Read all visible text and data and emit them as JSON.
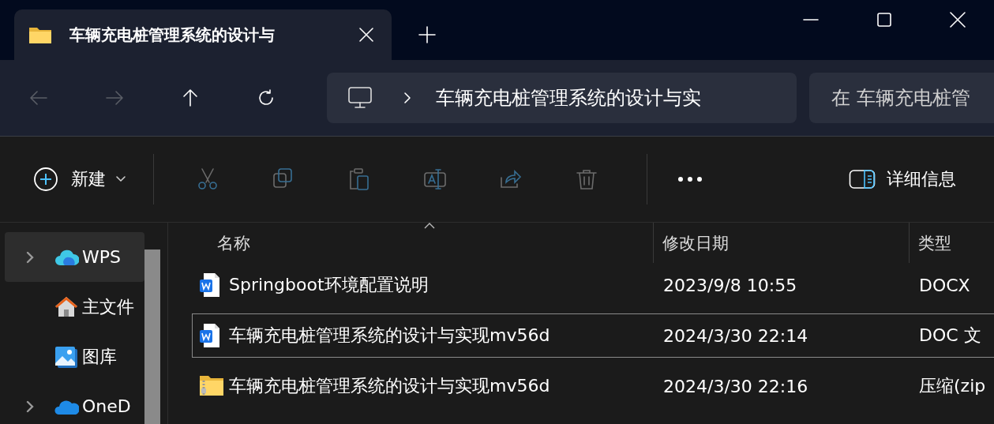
{
  "tab": {
    "title": "车辆充电桩管理系统的设计与"
  },
  "nav_buttons": [
    {
      "kind": "back",
      "disabled": true
    },
    {
      "kind": "forward",
      "disabled": true
    },
    {
      "kind": "up",
      "disabled": false
    },
    {
      "kind": "refresh",
      "disabled": false
    }
  ],
  "address": {
    "path": "车辆充电桩管理系统的设计与实"
  },
  "search": {
    "placeholder": "在 车辆充电桩管"
  },
  "toolbar": {
    "new_label": "新建",
    "actions": [
      {
        "kind": "cut",
        "disabled": true
      },
      {
        "kind": "copy",
        "disabled": true
      },
      {
        "kind": "paste",
        "disabled": true
      },
      {
        "kind": "rename",
        "disabled": true
      },
      {
        "kind": "share",
        "disabled": true
      },
      {
        "kind": "delete",
        "disabled": true
      }
    ],
    "details_label": "详细信息"
  },
  "sidebar": {
    "items": [
      {
        "label": "WPS",
        "kind": "cloud",
        "expandable": true,
        "selected": true
      },
      {
        "label": "主文件",
        "kind": "home",
        "expandable": false,
        "selected": false
      },
      {
        "label": "图库",
        "kind": "gallery",
        "expandable": false,
        "selected": false
      },
      {
        "label": "OneD",
        "kind": "onedrive",
        "expandable": true,
        "selected": false
      }
    ]
  },
  "table": {
    "columns": [
      "名称",
      "修改日期",
      "类型"
    ],
    "rows": [
      {
        "kind": "word",
        "name": "Springboot环境配置说明",
        "modified": "2023/9/8 10:55",
        "type": "DOCX",
        "focused": false
      },
      {
        "kind": "word",
        "name": "车辆充电桩管理系统的设计与实现mv56d",
        "modified": "2024/3/30 22:14",
        "type": "DOC 文",
        "focused": true
      },
      {
        "kind": "zip",
        "name": "车辆充电桩管理系统的设计与实现mv56d",
        "modified": "2024/3/30 22:16",
        "type": "压缩(zip",
        "focused": false
      }
    ]
  }
}
